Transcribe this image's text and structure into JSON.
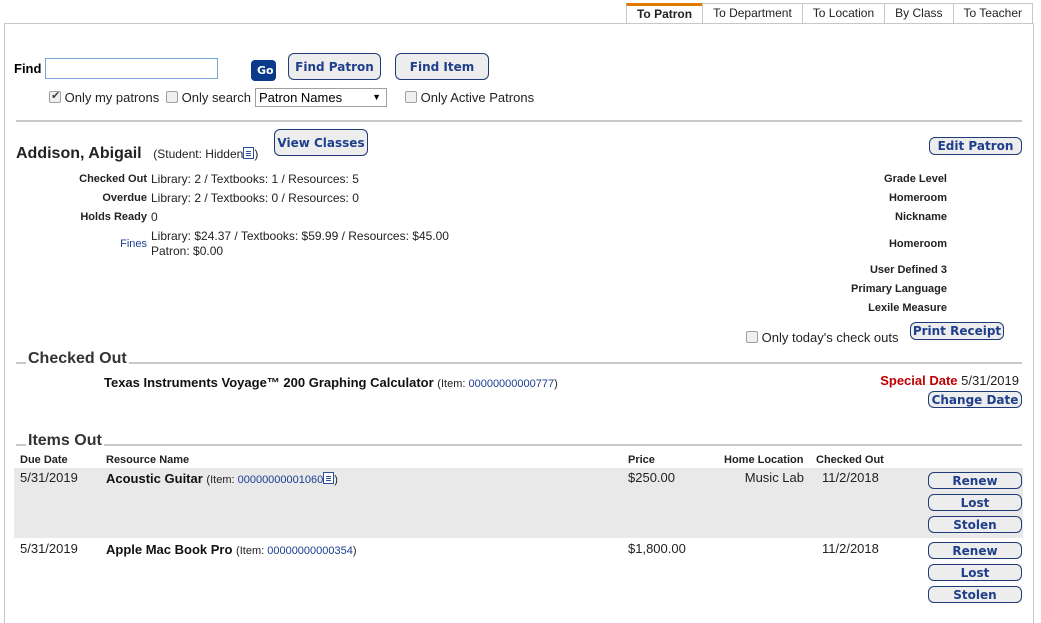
{
  "tabs": [
    {
      "label": "To Patron",
      "active": true
    },
    {
      "label": "To Department",
      "active": false
    },
    {
      "label": "To Location",
      "active": false
    },
    {
      "label": "By Class",
      "active": false
    },
    {
      "label": "To Teacher",
      "active": false
    }
  ],
  "search": {
    "find_label": "Find",
    "find_value": "",
    "go_label": "Go",
    "find_patron_label": "Find Patron",
    "find_item_label": "Find Item",
    "only_my_patrons_label": "Only my patrons",
    "only_my_patrons_checked": true,
    "only_search_label": "Only search",
    "only_search_checked": false,
    "search_scope_selected": "Patron Names",
    "only_active_label": "Only Active Patrons",
    "only_active_checked": false
  },
  "patron": {
    "name": "Addison, Abigail",
    "type_text": "(Student: Hidden",
    "type_close": ")",
    "view_classes_label": "View Classes",
    "edit_patron_label": "Edit Patron",
    "stats": [
      {
        "label": "Checked Out",
        "value": "Library: 2 / Textbooks: 1 / Resources: 5"
      },
      {
        "label": "Overdue",
        "value": "Library: 2 / Textbooks: 0 / Resources: 0"
      },
      {
        "label": "Holds Ready",
        "value": "0"
      }
    ],
    "fines_label": "Fines",
    "fines_line1": "Library: $24.37 / Textbooks: $59.99 / Resources: $45.00",
    "fines_line2": "Patron: $0.00",
    "fields": [
      {
        "label": "Grade Level",
        "value": ""
      },
      {
        "label": "Homeroom",
        "value": ""
      },
      {
        "label": "Nickname",
        "value": ""
      },
      {
        "label": "Homeroom",
        "value": ""
      },
      {
        "label": "User Defined 3",
        "value": ""
      },
      {
        "label": "Primary Language",
        "value": ""
      },
      {
        "label": "Lexile Measure",
        "value": ""
      }
    ],
    "only_today_label": "Only today's check outs",
    "only_today_checked": false,
    "print_receipt_label": "Print Receipt"
  },
  "checked_out": {
    "title": "Checked Out",
    "item_name": "Texas Instruments Voyage™ 200 Graphing Calculator",
    "item_prefix": "(Item: ",
    "item_barcode": "00000000000777",
    "item_suffix": ")",
    "special_date_label": "Special Date",
    "special_date_value": "5/31/2019",
    "change_date_label": "Change Date"
  },
  "items_out": {
    "title": "Items Out",
    "columns": [
      "Due Date",
      "Resource Name",
      "Price",
      "Home Location",
      "Checked Out"
    ],
    "rows": [
      {
        "due_date": "5/31/2019",
        "name": "Acoustic Guitar",
        "item_prefix": "(Item: ",
        "barcode": "00000000001060",
        "item_suffix": ")",
        "has_note_icon": true,
        "price": "$250.00",
        "home_location": "Music Lab",
        "checked_out": "11/2/2018",
        "actions": [
          "Renew",
          "Lost",
          "Stolen"
        ]
      },
      {
        "due_date": "5/31/2019",
        "name": "Apple Mac Book Pro",
        "item_prefix": "(Item: ",
        "barcode": "00000000000354",
        "item_suffix": ")",
        "has_note_icon": false,
        "price": "$1,800.00",
        "home_location": "",
        "checked_out": "11/2/2018",
        "actions": [
          "Renew",
          "Lost",
          "Stolen"
        ]
      }
    ]
  }
}
